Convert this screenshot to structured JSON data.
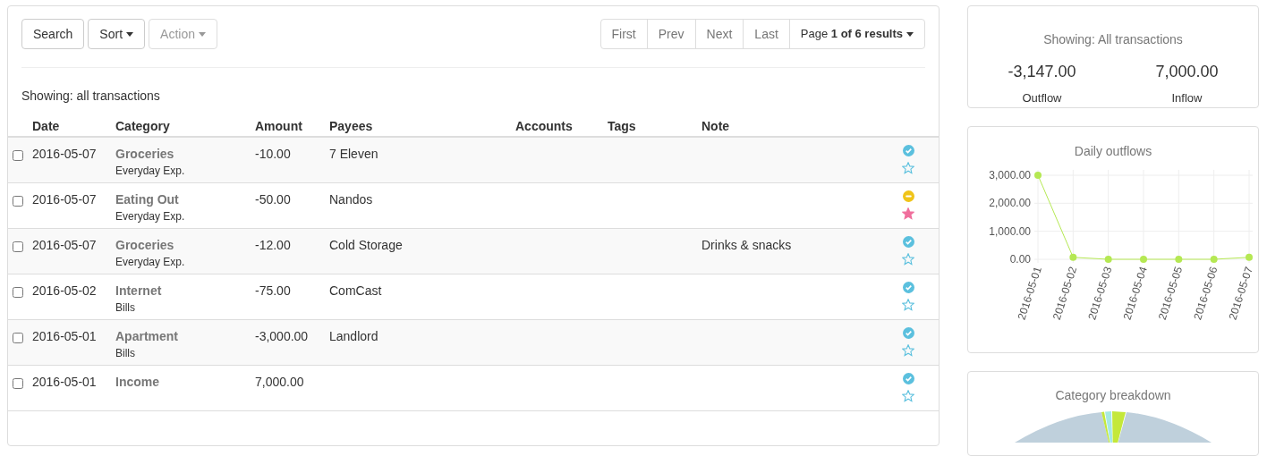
{
  "toolbar": {
    "buttons": [
      {
        "label": "Search",
        "caret": false,
        "disabled": false
      },
      {
        "label": "Sort",
        "caret": true,
        "disabled": false
      },
      {
        "label": "Action",
        "caret": true,
        "disabled": true
      }
    ]
  },
  "pagination": {
    "links": [
      "First",
      "Prev",
      "Next",
      "Last"
    ],
    "page_menu": "Page **1 of 6 results**"
  },
  "showing": "Showing: all transactions",
  "table": {
    "columns": [
      "Date",
      "Category",
      "Amount",
      "Payees",
      "Accounts",
      "Tags",
      "Note"
    ],
    "rows": [
      {
        "checked": false,
        "date": "2016-05-07",
        "category": "Groceries",
        "group": "Everyday Exp.",
        "amount": "-10.00",
        "payee": "7 Eleven",
        "note": "",
        "cleared": true,
        "starred": false
      },
      {
        "checked": false,
        "date": "2016-05-07",
        "category": "Eating Out",
        "group": "Everyday Exp.",
        "amount": "-50.00",
        "payee": "Nandos",
        "note": "",
        "cleared": false,
        "starred": true
      },
      {
        "checked": false,
        "date": "2016-05-07",
        "category": "Groceries",
        "group": "Everyday Exp.",
        "amount": "-12.00",
        "payee": "Cold Storage",
        "note": "Drinks & snacks",
        "cleared": true,
        "starred": false
      },
      {
        "checked": false,
        "date": "2016-05-02",
        "category": "Internet",
        "group": "Bills",
        "amount": "-75.00",
        "payee": "ComCast",
        "note": "",
        "cleared": true,
        "starred": false
      },
      {
        "checked": false,
        "date": "2016-05-01",
        "category": "Apartment",
        "group": "Bills",
        "amount": "-3,000.00",
        "payee": "Landlord",
        "note": "",
        "cleared": true,
        "starred": false
      },
      {
        "checked": false,
        "date": "2016-05-01",
        "category": "Income",
        "group": "",
        "amount": "7,000.00",
        "payee": "",
        "note": "",
        "cleared": true,
        "starred": false
      }
    ]
  },
  "summary": {
    "title": "Showing: All transactions",
    "stats": [
      {
        "value": "-3,147.00",
        "label": "Outflow"
      },
      {
        "value": "7,000.00",
        "label": "Inflow"
      }
    ]
  },
  "daily_outflows": {
    "chart_data": {
      "type": "line",
      "title": "Daily outflows",
      "categories": [
        "2016-05-01",
        "2016-05-02",
        "2016-05-03",
        "2016-05-04",
        "2016-05-05",
        "2016-05-06",
        "2016-05-07"
      ],
      "series": [
        {
          "color": "#b5e853",
          "marker": true,
          "values": [
            3000,
            70,
            0,
            0,
            0,
            0,
            70
          ]
        }
      ],
      "grid": true,
      "ylim": [
        0,
        3000
      ],
      "yticks": [
        {
          "value": 0,
          "label": "0.00"
        },
        {
          "value": 1000,
          "label": "1,000.00"
        },
        {
          "value": 2000,
          "label": "2,000.00"
        },
        {
          "value": 3000,
          "label": "3,000.00"
        }
      ]
    }
  },
  "category_breakdown": {
    "title": "Category breakdown"
  }
}
